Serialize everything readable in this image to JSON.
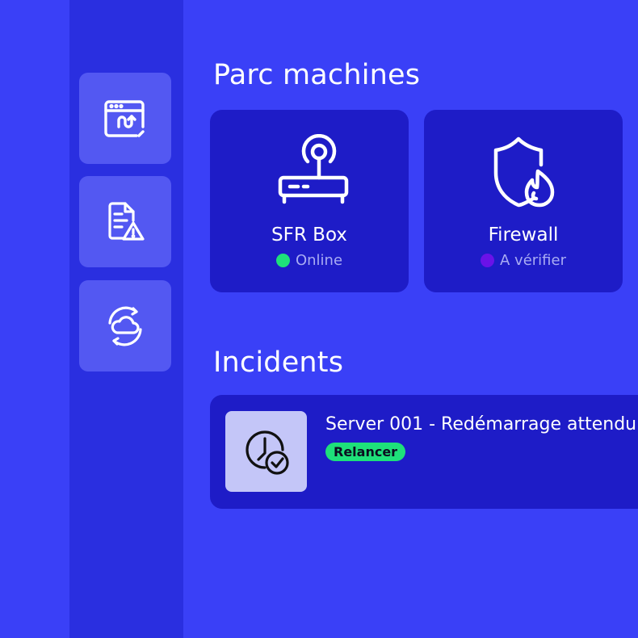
{
  "sidebar": {
    "items": [
      {
        "icon": "browser-transfer-icon"
      },
      {
        "icon": "document-warning-icon"
      },
      {
        "icon": "cloud-sync-icon"
      }
    ]
  },
  "devices": {
    "title": "Parc machines",
    "items": [
      {
        "name": "SFR Box",
        "status": "Online",
        "status_color": "#1ee07a",
        "icon": "router-icon"
      },
      {
        "name": "Firewall",
        "status": "A vérifier",
        "status_color": "#6a12e8",
        "icon": "shield-fire-icon"
      }
    ]
  },
  "incidents": {
    "title": "Incidents",
    "items": [
      {
        "title": "Server 001 - Redémarrage attendu",
        "action": "Relancer",
        "icon": "clock-check-icon"
      }
    ]
  },
  "colors": {
    "background": "#3a40f7",
    "sidebar": "#2a2fe0",
    "card": "#1e1cc7",
    "success": "#1ee07a"
  }
}
